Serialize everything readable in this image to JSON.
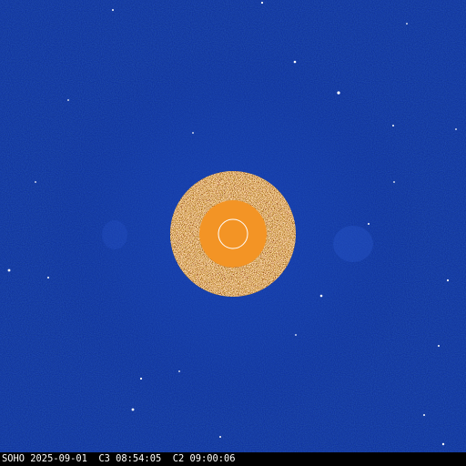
{
  "image": {
    "observatory": "SOHO",
    "date": "2025-09-01",
    "c3_label": "C3",
    "c3_time": "08:54:05",
    "c2_label": "C2",
    "c2_time": "09:00:06"
  },
  "colors": {
    "background": "#0a2a9a",
    "occulter_inner": "#f39425",
    "occulter_ring": "#ffffff",
    "c2_noise_dark": "#3a1f10",
    "c2_noise_light": "#f7e6d2",
    "caption_bar": "#000000",
    "caption_text": "#ffffff"
  }
}
